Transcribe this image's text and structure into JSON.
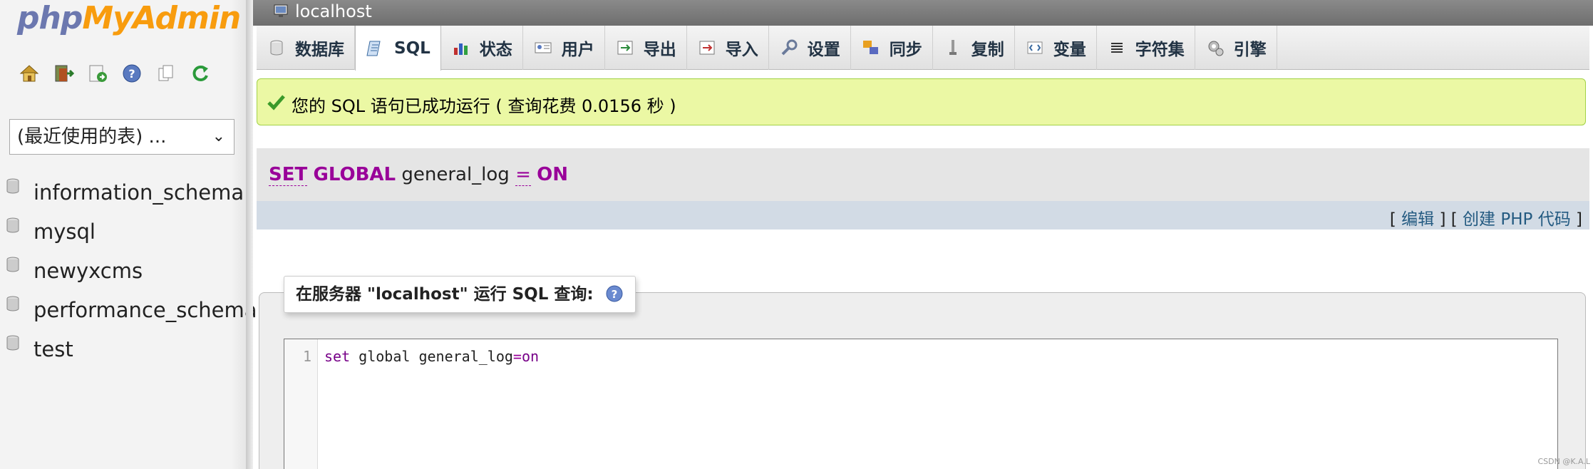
{
  "logo": {
    "part1": "php",
    "part2": "MyAdmin"
  },
  "nav_icons": [
    "home-icon",
    "exit-icon",
    "sql-query-icon",
    "docs-icon",
    "copy-icon",
    "refresh-icon"
  ],
  "recent_tables": {
    "value": "(最近使用的表) ..."
  },
  "databases": [
    "information_schema",
    "mysql",
    "newyxcms",
    "performance_schema",
    "test"
  ],
  "server": {
    "label": "localhost"
  },
  "tabs": [
    {
      "label": "数据库",
      "icon": "database-icon"
    },
    {
      "label": "SQL",
      "icon": "sql-icon"
    },
    {
      "label": "状态",
      "icon": "status-icon"
    },
    {
      "label": "用户",
      "icon": "users-icon"
    },
    {
      "label": "导出",
      "icon": "export-icon"
    },
    {
      "label": "导入",
      "icon": "import-icon"
    },
    {
      "label": "设置",
      "icon": "settings-icon"
    },
    {
      "label": "同步",
      "icon": "sync-icon"
    },
    {
      "label": "复制",
      "icon": "replication-icon"
    },
    {
      "label": "变量",
      "icon": "variables-icon"
    },
    {
      "label": "字符集",
      "icon": "charset-icon"
    },
    {
      "label": "引擎",
      "icon": "engines-icon"
    }
  ],
  "active_tab": "SQL",
  "success": {
    "message": "您的 SQL 语句已成功运行 ( 查询花费 0.0156 秒 )"
  },
  "executed_sql": {
    "kw1": "SET",
    "kw2": "GLOBAL",
    "ident": "general_log",
    "op": "=",
    "val": "ON"
  },
  "sql_links": {
    "open1": "[",
    "edit": "编辑",
    "mid": "] [",
    "php": "创建 PHP 代码",
    "close": "]"
  },
  "query_box": {
    "legend": "在服务器 \"localhost\" 运行 SQL 查询:"
  },
  "editor": {
    "line_number": "1",
    "kw": "set",
    "text": " global general_log",
    "op": "=",
    "val": "on"
  },
  "watermark": "CSDN @K.A.L",
  "colors": {
    "accent": "#235a81",
    "success_bg": "#ebf8a4",
    "keyword": "#990099"
  }
}
